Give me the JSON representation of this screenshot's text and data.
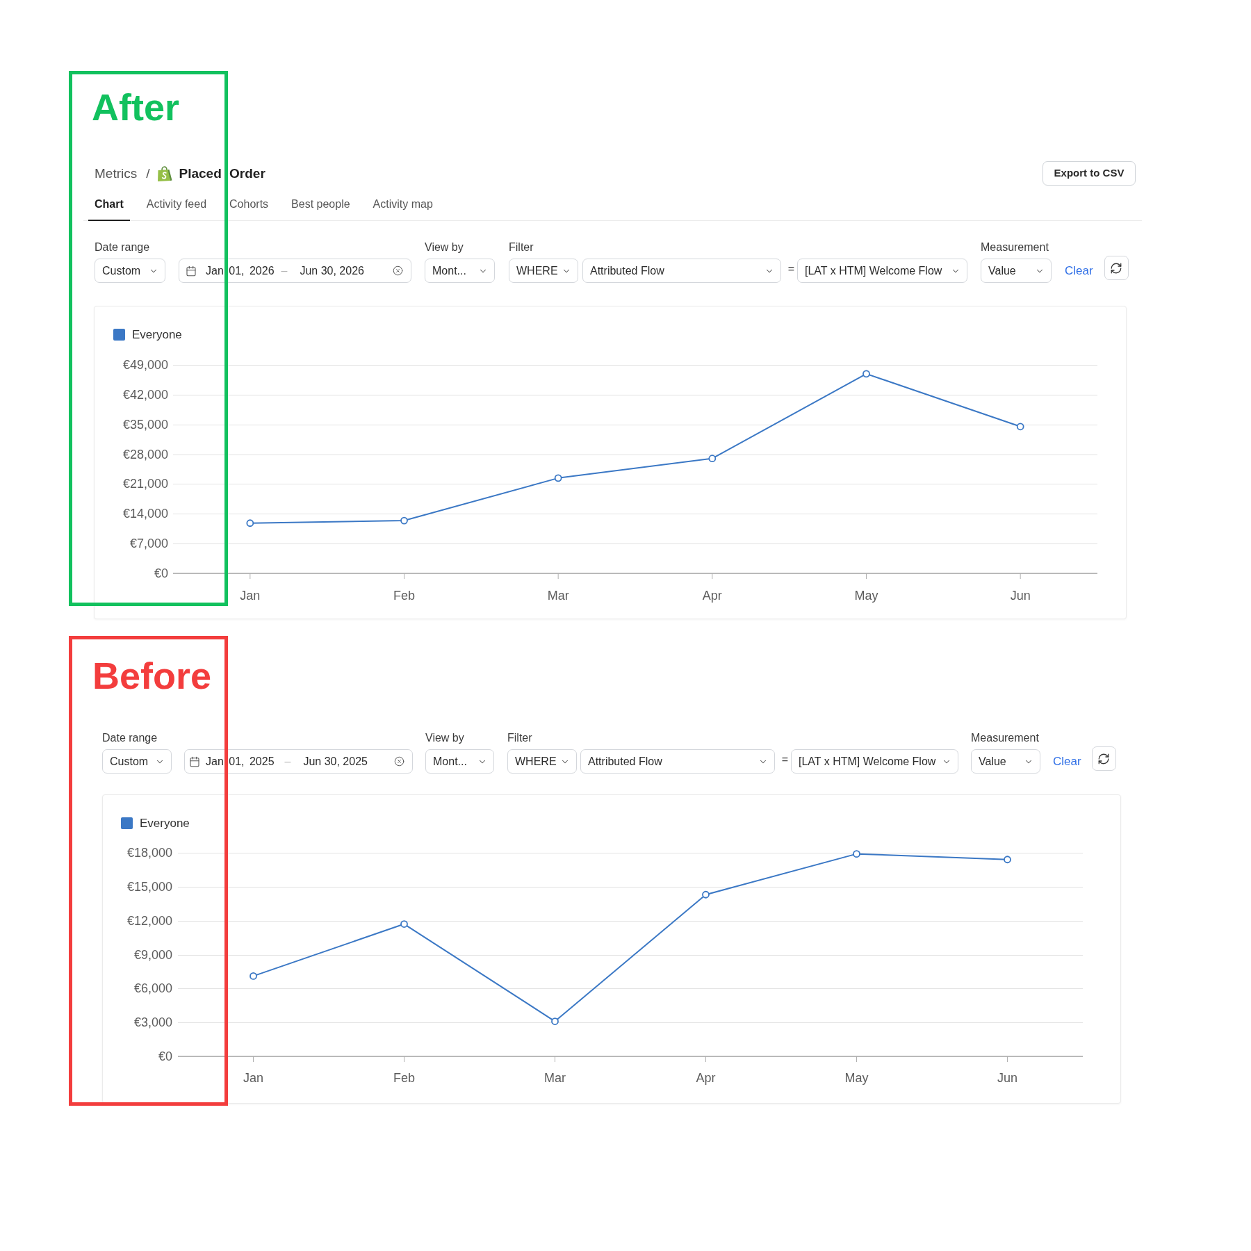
{
  "panels": [
    {
      "label": "After",
      "color": "#12c15e",
      "breadcrumb": {
        "parent": "Metrics",
        "separator": "/",
        "current": "Placed Order"
      },
      "export_button": "Export to CSV",
      "tabs": [
        {
          "label": "Chart",
          "selected": true
        },
        {
          "label": "Activity feed",
          "selected": false
        },
        {
          "label": "Cohorts",
          "selected": false
        },
        {
          "label": "Best people",
          "selected": false
        },
        {
          "label": "Activity map",
          "selected": false
        }
      ],
      "filters": {
        "date_range": {
          "label": "Date range",
          "preset": "Custom",
          "start": "Jan 01, 2026",
          "separator": "–",
          "end": "Jun 30, 2026"
        },
        "view_by": {
          "label": "View by",
          "value": "Mont..."
        },
        "filter": {
          "label": "Filter",
          "operator": "WHERE",
          "field": "Attributed Flow",
          "comparator": "=",
          "value": "[LAT x HTM] Welcome Flow"
        },
        "measurement": {
          "label": "Measurement",
          "value": "Value"
        },
        "clear": "Clear"
      },
      "chart": {
        "chart_data": {
          "type": "line",
          "grid": true,
          "categories": [
            "Jan",
            "Feb",
            "Mar",
            "Apr",
            "May",
            "Jun"
          ],
          "series": [
            {
              "name": "Everyone",
              "color": "#3b78c5",
              "marker": "circle",
              "values": [
                11800,
                12400,
                22400,
                27000,
                46900,
                34500
              ]
            }
          ],
          "ylim": [
            0,
            49000
          ],
          "yticks": [
            {
              "value": 0,
              "label": "€0"
            },
            {
              "value": 7000,
              "label": "€7,000"
            },
            {
              "value": 14000,
              "label": "€14,000"
            },
            {
              "value": 21000,
              "label": "€21,000"
            },
            {
              "value": 28000,
              "label": "€28,000"
            },
            {
              "value": 35000,
              "label": "€35,000"
            },
            {
              "value": 42000,
              "label": "€42,000"
            },
            {
              "value": 49000,
              "label": "€49,000"
            }
          ]
        }
      }
    },
    {
      "label": "Before",
      "color": "#f33d3d",
      "filters": {
        "date_range": {
          "label": "Date range",
          "preset": "Custom",
          "start": "Jan 01, 2025",
          "separator": "–",
          "end": "Jun 30, 2025"
        },
        "view_by": {
          "label": "View by",
          "value": "Mont..."
        },
        "filter": {
          "label": "Filter",
          "operator": "WHERE",
          "field": "Attributed Flow",
          "comparator": "=",
          "value": "[LAT x HTM] Welcome Flow"
        },
        "measurement": {
          "label": "Measurement",
          "value": "Value"
        },
        "clear": "Clear"
      },
      "chart": {
        "chart_data": {
          "type": "line",
          "grid": true,
          "categories": [
            "Jan",
            "Feb",
            "Mar",
            "Apr",
            "May",
            "Jun"
          ],
          "series": [
            {
              "name": "Everyone",
              "color": "#3b78c5",
              "marker": "circle",
              "values": [
                7100,
                11700,
                3100,
                14300,
                17900,
                17400
              ]
            }
          ],
          "ylim": [
            0,
            18000
          ],
          "yticks": [
            {
              "value": 0,
              "label": "€0"
            },
            {
              "value": 3000,
              "label": "€3,000"
            },
            {
              "value": 6000,
              "label": "€6,000"
            },
            {
              "value": 9000,
              "label": "€9,000"
            },
            {
              "value": 12000,
              "label": "€12,000"
            },
            {
              "value": 15000,
              "label": "€15,000"
            },
            {
              "value": 18000,
              "label": "€18,000"
            }
          ]
        }
      }
    }
  ]
}
